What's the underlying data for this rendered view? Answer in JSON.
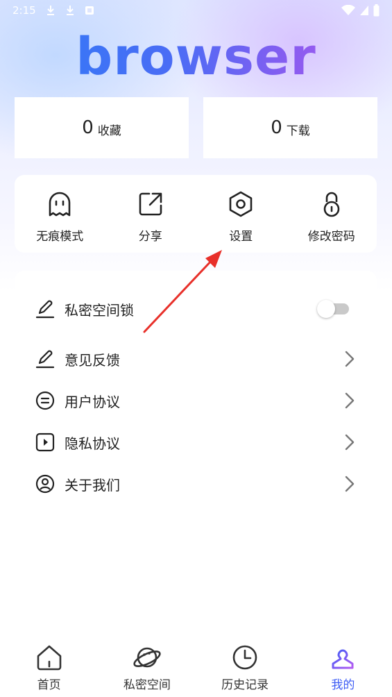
{
  "status_bar": {
    "time": "2:15"
  },
  "logo_text": "browser",
  "stats": [
    {
      "count": "0",
      "label": "收藏"
    },
    {
      "count": "0",
      "label": "下载"
    }
  ],
  "quick_actions": [
    {
      "label": "无痕模式",
      "icon": "ghost-icon"
    },
    {
      "label": "分享",
      "icon": "share-icon"
    },
    {
      "label": "设置",
      "icon": "hexagon-settings-icon"
    },
    {
      "label": "修改密码",
      "icon": "lock-icon"
    }
  ],
  "menu": {
    "private_lock": {
      "label": "私密空间锁",
      "enabled": false
    },
    "items": [
      {
        "label": "意见反馈",
        "icon": "pen-icon"
      },
      {
        "label": "用户协议",
        "icon": "document-circle-icon"
      },
      {
        "label": "隐私协议",
        "icon": "play-square-icon"
      },
      {
        "label": "关于我们",
        "icon": "user-circle-icon"
      }
    ]
  },
  "bottom_nav": [
    {
      "label": "首页",
      "icon": "home-icon",
      "active": false
    },
    {
      "label": "私密空间",
      "icon": "planet-icon",
      "active": false
    },
    {
      "label": "历史记录",
      "icon": "clock-icon",
      "active": false
    },
    {
      "label": "我的",
      "icon": "profile-icon",
      "active": true
    }
  ],
  "colors": {
    "accent": "#3d5cf5",
    "logo_start": "#2f7cf6",
    "logo_end": "#b45cf2",
    "annotation_arrow": "#e8302a"
  }
}
